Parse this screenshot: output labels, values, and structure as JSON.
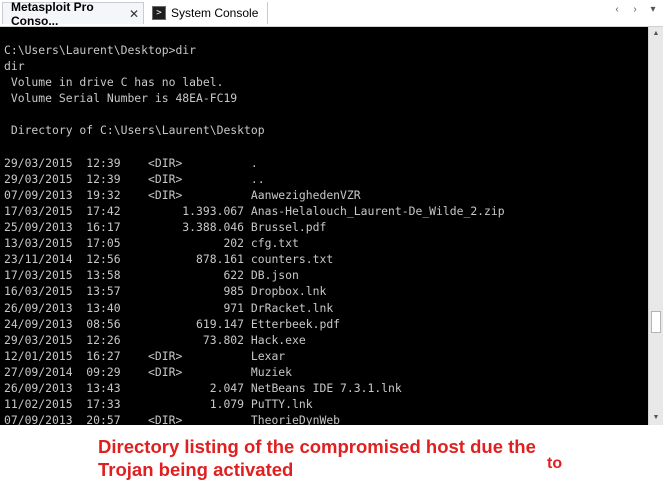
{
  "tabs": [
    {
      "label": "Metasploit Pro Conso...",
      "active": true,
      "close": "✕"
    },
    {
      "label": "System Console",
      "active": false,
      "icon": "console-icon"
    }
  ],
  "window_controls": [
    "‹",
    "›",
    "▾"
  ],
  "console": {
    "background": "#000000",
    "text_color": "#c8c8c8",
    "lines": [
      "C:\\Users\\Laurent\\Desktop>dir",
      "dir",
      " Volume in drive C has no label.",
      " Volume Serial Number is 48EA-FC19",
      "",
      " Directory of C:\\Users\\Laurent\\Desktop",
      "",
      "29/03/2015  12:39    <DIR>          .",
      "29/03/2015  12:39    <DIR>          ..",
      "07/09/2013  19:32    <DIR>          AanwezighedenVZR",
      "17/03/2015  17:42         1.393.067 Anas-Helalouch_Laurent-De_Wilde_2.zip",
      "25/09/2013  16:17         3.388.046 Brussel.pdf",
      "13/03/2015  17:05               202 cfg.txt",
      "23/11/2014  12:56           878.161 counters.txt",
      "17/03/2015  13:58               622 DB.json",
      "16/03/2015  13:57               985 Dropbox.lnk",
      "26/09/2013  13:40               971 DrRacket.lnk",
      "24/09/2013  08:56           619.147 Etterbeek.pdf",
      "29/03/2015  12:26            73.802 Hack.exe",
      "12/01/2015  16:27    <DIR>          Lexar",
      "27/09/2014  09:29    <DIR>          Muziek",
      "26/09/2013  13:43             2.047 NetBeans IDE 7.3.1.lnk",
      "11/02/2015  17:33             1.079 PuTTY.lnk",
      "07/09/2013  20:57    <DIR>          TheorieDynWeb"
    ]
  },
  "annotation": {
    "lines": [
      "Directory listing of the compromised host due the",
      "Trojan being activated"
    ],
    "extra": "to",
    "color": "#e02020"
  }
}
